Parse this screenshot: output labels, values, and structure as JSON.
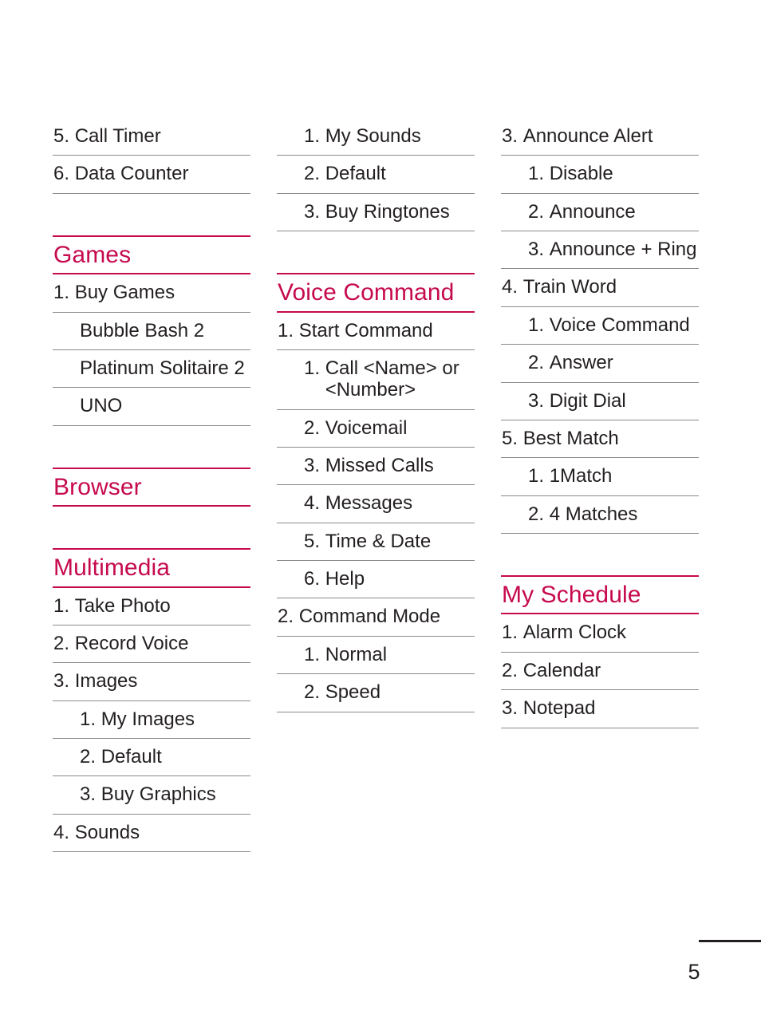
{
  "page": {
    "number": "5",
    "accent_color": "#c60a4e",
    "text_color": "#231f20",
    "rule_color": "#8a8a8a"
  },
  "columns": [
    {
      "id": "column-1",
      "blocks": [
        {
          "type": "list",
          "spaced": false,
          "items": [
            {
              "num": "5. ",
              "label": "Call Timer",
              "level": 1
            },
            {
              "num": "6. ",
              "label": "Data Counter",
              "level": 1
            }
          ]
        },
        {
          "type": "section",
          "spaced": true,
          "heading": "Games",
          "items": [
            {
              "num": "1. ",
              "label": "Buy Games",
              "level": 1
            },
            {
              "num": "",
              "label": "Bubble Bash 2",
              "level": 2
            },
            {
              "num": "",
              "label": "Platinum Solitaire 2",
              "level": 2
            },
            {
              "num": "",
              "label": "UNO",
              "level": 2
            }
          ]
        },
        {
          "type": "section",
          "spaced": true,
          "heading": "Browser",
          "items": []
        },
        {
          "type": "section",
          "spaced": true,
          "heading": "Multimedia",
          "items": [
            {
              "num": "1. ",
              "label": "Take Photo",
              "level": 1
            },
            {
              "num": "2. ",
              "label": "Record Voice",
              "level": 1
            },
            {
              "num": "3. ",
              "label": "Images",
              "level": 1
            },
            {
              "num": "1. ",
              "label": "My Images",
              "level": 2
            },
            {
              "num": "2. ",
              "label": "Default",
              "level": 2
            },
            {
              "num": "3. ",
              "label": "Buy Graphics",
              "level": 2
            },
            {
              "num": "4. ",
              "label": "Sounds",
              "level": 1
            }
          ]
        }
      ]
    },
    {
      "id": "column-2",
      "blocks": [
        {
          "type": "list",
          "spaced": false,
          "items": [
            {
              "num": "1. ",
              "label": "My Sounds",
              "level": 2
            },
            {
              "num": "2. ",
              "label": "Default",
              "level": 2
            },
            {
              "num": "3. ",
              "label": "Buy Ringtones",
              "level": 2
            }
          ]
        },
        {
          "type": "section",
          "spaced": true,
          "heading": "Voice Command",
          "items": [
            {
              "num": "1. ",
              "label": "Start Command",
              "level": 1
            },
            {
              "num": "1. ",
              "label": "Call <Name> or <Number>",
              "level": 2
            },
            {
              "num": "2. ",
              "label": "Voicemail",
              "level": 2
            },
            {
              "num": "3. ",
              "label": "Missed Calls",
              "level": 2
            },
            {
              "num": "4. ",
              "label": "Messages",
              "level": 2
            },
            {
              "num": "5. ",
              "label": "Time & Date",
              "level": 2
            },
            {
              "num": "6. ",
              "label": "Help",
              "level": 2
            },
            {
              "num": "2. ",
              "label": "Command Mode",
              "level": 1
            },
            {
              "num": "1. ",
              "label": "Normal",
              "level": 2
            },
            {
              "num": "2. ",
              "label": "Speed",
              "level": 2
            }
          ]
        }
      ]
    },
    {
      "id": "column-3",
      "blocks": [
        {
          "type": "list",
          "spaced": false,
          "items": [
            {
              "num": "3. ",
              "label": "Announce Alert",
              "level": 1
            },
            {
              "num": "1. ",
              "label": "Disable",
              "level": 2
            },
            {
              "num": "2. ",
              "label": "Announce",
              "level": 2
            },
            {
              "num": "3. ",
              "label": "Announce + Ring",
              "level": 2
            },
            {
              "num": "4. ",
              "label": "Train Word",
              "level": 1
            },
            {
              "num": "1. ",
              "label": "Voice Command",
              "level": 2
            },
            {
              "num": "2. ",
              "label": "Answer",
              "level": 2
            },
            {
              "num": "3. ",
              "label": "Digit Dial",
              "level": 2
            },
            {
              "num": "5. ",
              "label": "Best Match",
              "level": 1
            },
            {
              "num": "1. ",
              "label": "1Match",
              "level": 2
            },
            {
              "num": "2. ",
              "label": "4 Matches",
              "level": 2
            }
          ]
        },
        {
          "type": "section",
          "spaced": true,
          "heading": "My Schedule",
          "items": [
            {
              "num": "1. ",
              "label": "Alarm Clock",
              "level": 1
            },
            {
              "num": "2. ",
              "label": "Calendar",
              "level": 1
            },
            {
              "num": "3. ",
              "label": "Notepad",
              "level": 1
            }
          ]
        }
      ]
    }
  ]
}
